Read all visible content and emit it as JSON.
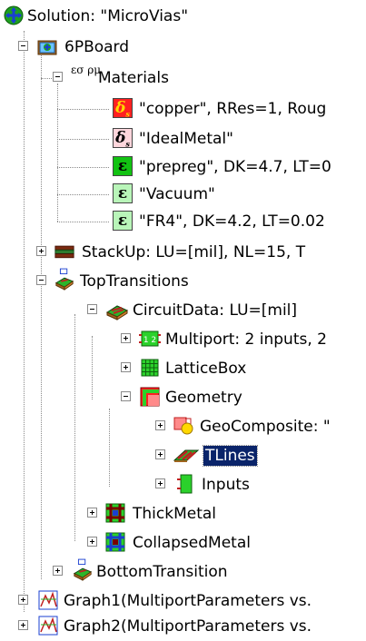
{
  "tree": {
    "solution": "Solution: \"MicroVias\"",
    "board": "6PBoard",
    "materials": {
      "label": "Materials",
      "icon_glyph": "εσ ρμ",
      "items": [
        {
          "label": "\"copper\", RRes=1, Roug",
          "symbol": "δ",
          "sub": "s",
          "style": "red"
        },
        {
          "label": "\"IdealMetal\"",
          "symbol": "δ",
          "sub": "s",
          "style": "pink"
        },
        {
          "label": "\"prepreg\", DK=4.7, LT=0",
          "symbol": "ε",
          "sub": "",
          "style": "green"
        },
        {
          "label": "\"Vacuum\"",
          "symbol": "ε",
          "sub": "",
          "style": "lgreen"
        },
        {
          "label": "\"FR4\", DK=4.2, LT=0.02",
          "symbol": "ε",
          "sub": "",
          "style": "lgreen"
        }
      ]
    },
    "stackup": "StackUp: LU=[mil], NL=15, T",
    "top_transitions": "TopTransitions",
    "circuit_data": "CircuitData: LU=[mil]",
    "multiport": "Multiport: 2 inputs, 2",
    "lattice_box": "LatticeBox",
    "geometry": "Geometry",
    "geo_composite": "GeoComposite: \"",
    "tlines": "TLines",
    "inputs": "Inputs",
    "thick_metal": "ThickMetal",
    "collapsed_metal": "CollapsedMetal",
    "bottom_transition": "BottomTransition",
    "graph1": "Graph1(MultiportParameters vs.",
    "graph2": "Graph2(MultiportParameters vs. "
  },
  "colors": {
    "selection": "#0a246a",
    "tree_line": "#8a8a8a"
  }
}
